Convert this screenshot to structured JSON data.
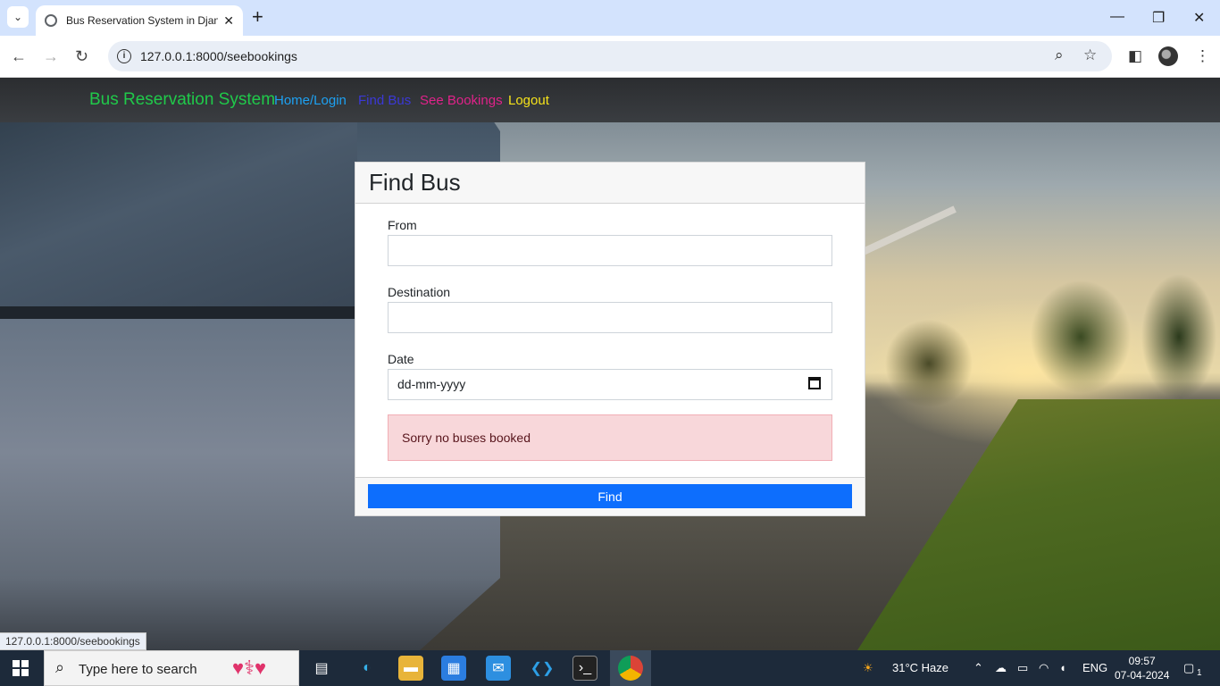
{
  "browser": {
    "tab_title": "Bus Reservation System in Djan",
    "url": "127.0.0.1:8000/seebookings",
    "status_url": "127.0.0.1:8000/seebookings"
  },
  "navbar": {
    "brand": "Bus Reservation System",
    "links": [
      {
        "label": "Home/Login",
        "color": "#1da1f2"
      },
      {
        "label": "Find Bus",
        "color": "#3b38d6"
      },
      {
        "label": "See Bookings",
        "color": "#e0228a"
      },
      {
        "label": "Logout",
        "color": "#f5e21b"
      }
    ]
  },
  "form": {
    "title": "Find Bus",
    "from_label": "From",
    "from_value": "",
    "destination_label": "Destination",
    "destination_value": "",
    "date_label": "Date",
    "date_placeholder": "dd-mm-yyyy",
    "alert": "Sorry no buses booked",
    "submit_label": "Find"
  },
  "taskbar": {
    "search_placeholder": "Type here to search",
    "weather": "31°C  Haze",
    "language": "ENG",
    "time": "09:57",
    "date": "07-04-2024",
    "notification_count": "1"
  },
  "colors": {
    "brand": "#20c94a",
    "primary": "#0d6efd",
    "alert_bg": "#f8d7da"
  }
}
